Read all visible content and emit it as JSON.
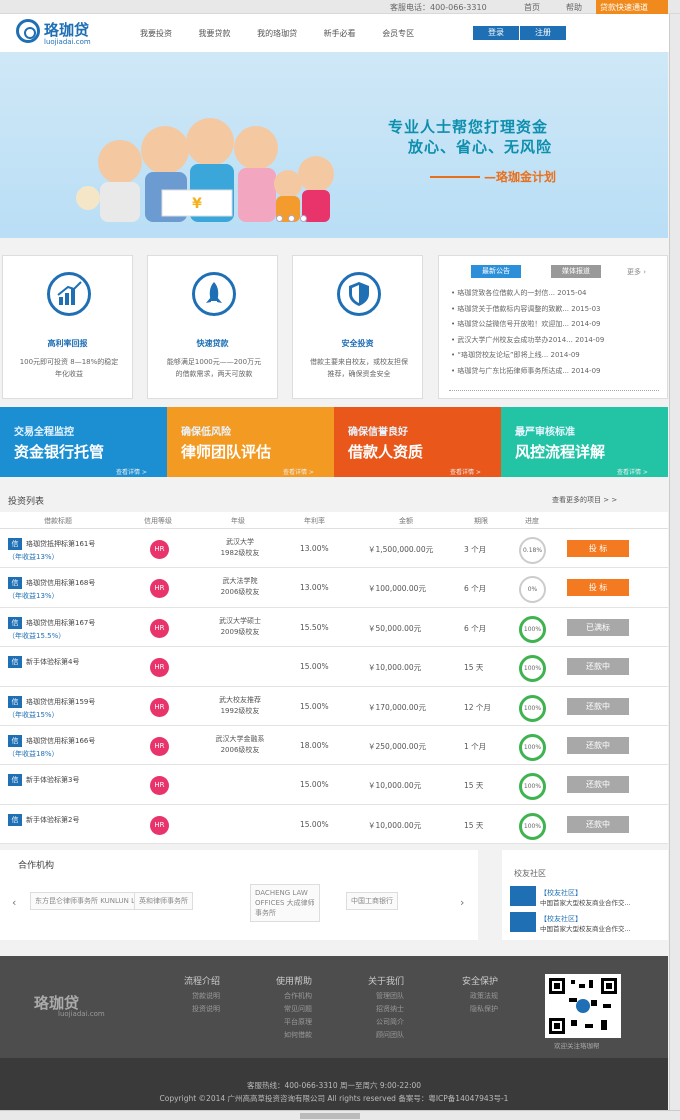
{
  "topbar": {
    "hotline": "客服电话：400-066-3310",
    "home": "首页",
    "help": "帮助",
    "quick": "贷款快速通道"
  },
  "header": {
    "logo_text": "珞珈贷",
    "logo_sub": "luojiadai.com",
    "nav": [
      "我要投资",
      "我要贷款",
      "我的珞珈贷",
      "新手必看",
      "会员专区"
    ],
    "login": "登录",
    "register": "注册"
  },
  "banner": {
    "line1": "专业人士帮您打理资金",
    "line2": "放心、省心、无风险",
    "line3": "—珞珈金计划"
  },
  "features": [
    {
      "title": "高利率回报",
      "desc": "100元即可投资 8—18%的稳定年化收益",
      "icon": "chart-icon"
    },
    {
      "title": "快速贷款",
      "desc": "能够满足1000元——200万元的借款需求，两天可放款",
      "icon": "rocket-icon"
    },
    {
      "title": "安全投资",
      "desc": "借款主要来自校友，或校友担保推荐，确保资金安全",
      "icon": "shield-icon"
    }
  ],
  "news": {
    "tab_latest": "最新公告",
    "tab_media": "媒体报道",
    "more": "更多 ›",
    "items": [
      "珞珈贷致各位借款人的一封信... 2015-04",
      "珞珈贷关于借款标内容调整的致歉... 2015-03",
      "珞珈贷公益微信号开放啦！欢迎加... 2014-09",
      "武汉大学广州校友会成功举办2014... 2014-09",
      "“珞珈贷校友论坛”即将上线... 2014-09",
      "珞珈贷与广东比拓律师事务所达成... 2014-09"
    ]
  },
  "promos": [
    {
      "p1": "交易全程监控",
      "p2": "资金银行托管",
      "p3": "查看详情 >",
      "color": "#1b8fd2"
    },
    {
      "p1": "确保低风险",
      "p2": "律师团队评估",
      "p3": "查看详情 >",
      "color": "#f39a23"
    },
    {
      "p1": "确保信誉良好",
      "p2": "借款人资质",
      "p3": "查看详情 >",
      "color": "#e9571b"
    },
    {
      "p1": "最严审核标准",
      "p2": "风控流程详解",
      "p3": "查看详情 >",
      "color": "#23c4a6"
    }
  ],
  "invest": {
    "title": "投资列表",
    "more": "查看更多的项目 > >",
    "columns": [
      "借款标题",
      "信用等级",
      "年级",
      "年利率",
      "金额",
      "期限",
      "进度"
    ],
    "rows": [
      {
        "badge": "信",
        "title": "珞珈贷抵押标第161号",
        "sub": "（年收益13%）",
        "grade": "HR",
        "school": "武汉大学\n1982级校友",
        "rate": "13.00%",
        "amount": "￥1,500,000.00元",
        "term": "3 个月",
        "progress": "0.18%",
        "full": false,
        "action": "投 标",
        "style": "orange"
      },
      {
        "badge": "信",
        "title": "珞珈贷信用标第168号",
        "sub": "（年收益13%）",
        "grade": "HR",
        "school": "武大法学院\n2006级校友",
        "rate": "13.00%",
        "amount": "￥100,000.00元",
        "term": "6 个月",
        "progress": "0%",
        "full": false,
        "action": "投 标",
        "style": "orange"
      },
      {
        "badge": "信",
        "title": "珞珈贷信用标第167号",
        "sub": "（年收益15.5%）",
        "grade": "HR",
        "school": "武汉大学硕士\n2009级校友",
        "rate": "15.50%",
        "amount": "￥50,000.00元",
        "term": "6 个月",
        "progress": "100%",
        "full": true,
        "action": "已满标",
        "style": "gray"
      },
      {
        "badge": "信",
        "title": "新手体验标第4号",
        "sub": "",
        "grade": "HR",
        "school": "",
        "rate": "15.00%",
        "amount": "￥10,000.00元",
        "term": "15 天",
        "progress": "100%",
        "full": true,
        "action": "还款中",
        "style": "gray"
      },
      {
        "badge": "信",
        "title": "珞珈贷信用标第159号",
        "sub": "（年收益15%）",
        "grade": "HR",
        "school": "武大校友推荐\n1992级校友",
        "rate": "15.00%",
        "amount": "￥170,000.00元",
        "term": "12 个月",
        "progress": "100%",
        "full": true,
        "action": "还款中",
        "style": "gray"
      },
      {
        "badge": "信",
        "title": "珞珈贷信用标第166号",
        "sub": "（年收益18%）",
        "grade": "HR",
        "school": "武汉大学金融系\n2006级校友",
        "rate": "18.00%",
        "amount": "￥250,000.00元",
        "term": "1 个月",
        "progress": "100%",
        "full": true,
        "action": "还款中",
        "style": "gray"
      },
      {
        "badge": "信",
        "title": "新手体验标第3号",
        "sub": "",
        "grade": "HR",
        "school": "",
        "rate": "15.00%",
        "amount": "￥10,000.00元",
        "term": "15 天",
        "progress": "100%",
        "full": true,
        "action": "还款中",
        "style": "gray"
      },
      {
        "badge": "信",
        "title": "新手体验标第2号",
        "sub": "",
        "grade": "HR",
        "school": "",
        "rate": "15.00%",
        "amount": "￥10,000.00元",
        "term": "15 天",
        "progress": "100%",
        "full": true,
        "action": "还款中",
        "style": "gray"
      }
    ]
  },
  "partners": {
    "title": "合作机构",
    "prev": "‹",
    "next": "›",
    "logos": [
      "东方昆仑律师事务所 KUNLUN LAW FIRM",
      "英和律师事务所",
      "DACHENG LAW OFFICES 大成律师事务所",
      "中国工商银行"
    ]
  },
  "community": {
    "title": "校友社区",
    "items": [
      {
        "tag": "【校友社区】",
        "text": "中国首家大型校友商业合作交..."
      },
      {
        "tag": "【校友社区】",
        "text": "中国首家大型校友商业合作交..."
      }
    ]
  },
  "footer": {
    "logo_text": "珞珈贷",
    "logo_sub": "luojiadai.com",
    "cols": [
      {
        "h": "流程介绍",
        "items": [
          "贷款说明",
          "投资说明"
        ]
      },
      {
        "h": "使用帮助",
        "items": [
          "合作机构",
          "常见问题",
          "平台原理",
          "如何借款"
        ]
      },
      {
        "h": "关于我们",
        "items": [
          "管理团队",
          "招贤纳士",
          "公司简介",
          "顾问团队"
        ]
      },
      {
        "h": "安全保护",
        "items": [
          "政策法规",
          "隐私保护"
        ]
      }
    ],
    "qr_caption": "欢迎关注珞珈帮"
  },
  "bottom": {
    "line1": "客服热线：400-066-3310 周一至周六 9:00-22:00",
    "line2": "Copyright ©2014 广州高高草投资咨询有限公司 All rights reserved 备案号：粤ICP备14047943号-1"
  }
}
